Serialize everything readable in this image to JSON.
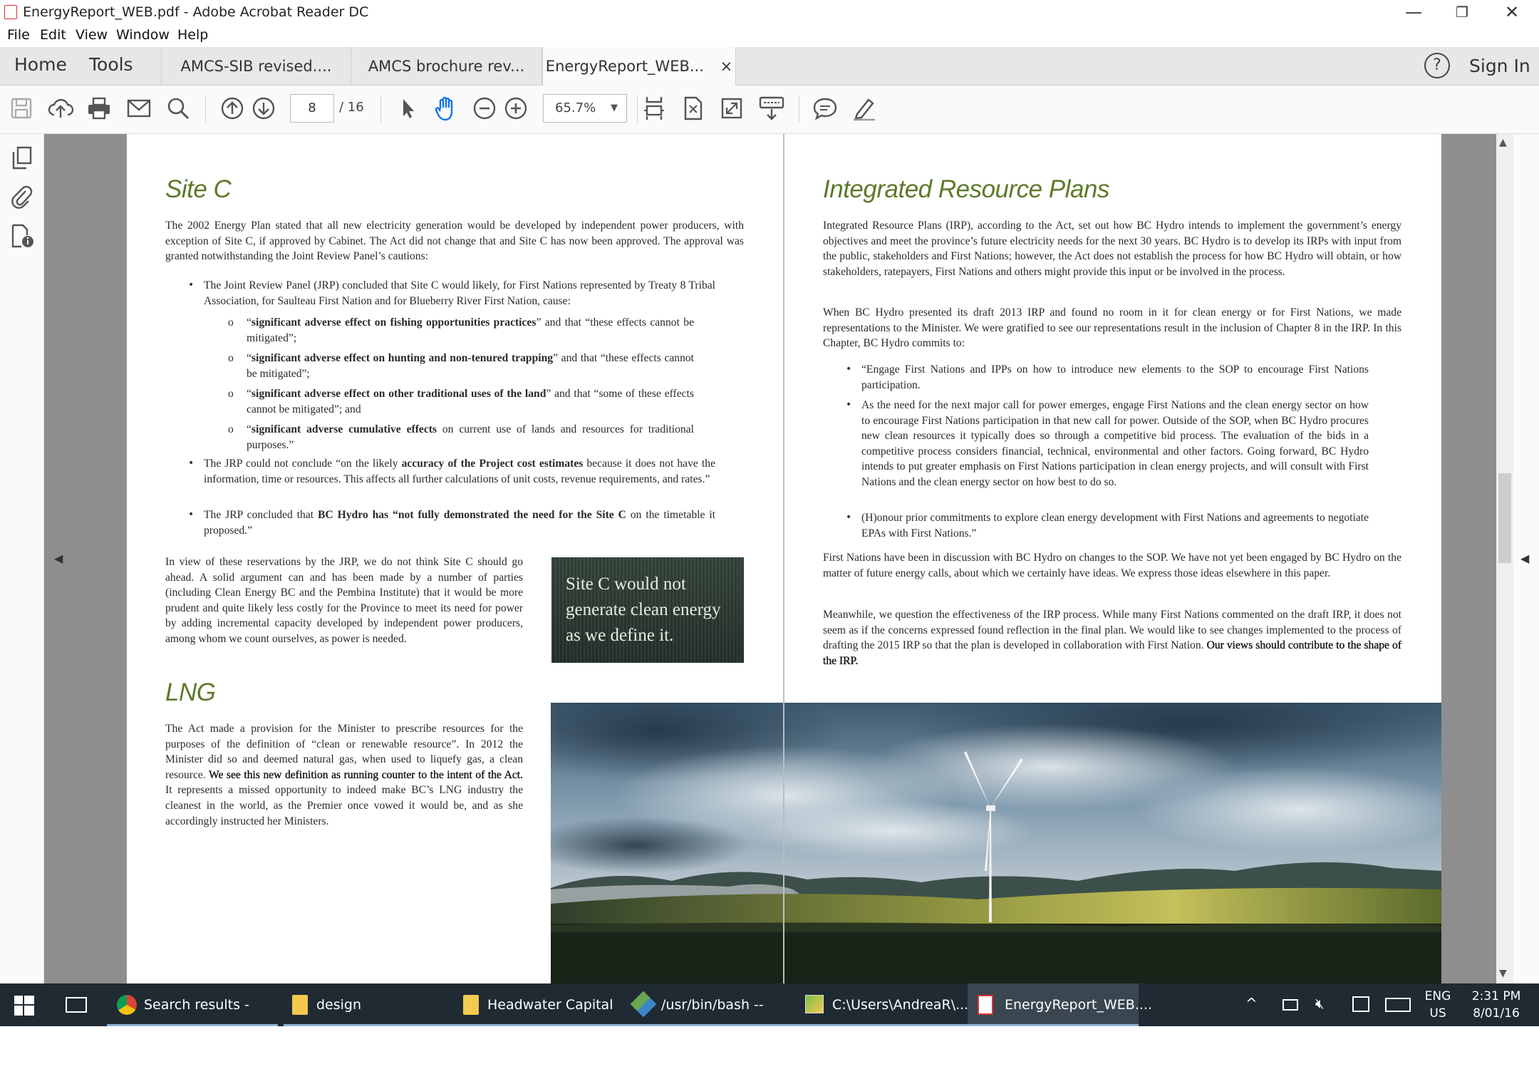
{
  "window": {
    "title": "EnergyReport_WEB.pdf - Adobe Acrobat Reader DC",
    "minimize": "—",
    "restore": "❐",
    "close": "✕"
  },
  "menu": [
    "File",
    "Edit",
    "View",
    "Window",
    "Help"
  ],
  "tabs": {
    "home": "Home",
    "tools": "Tools",
    "documents": [
      {
        "label": "AMCS-SIB revised...."
      },
      {
        "label": "AMCS brochure rev..."
      },
      {
        "label": "EnergyReport_WEB...",
        "close": "×"
      }
    ],
    "signin": "Sign In"
  },
  "toolbar": {
    "page_current": "8",
    "page_total": "/ 16",
    "zoom": "65.7%"
  },
  "left_page": {
    "heading1": "Site C",
    "p1": "The 2002 Energy Plan stated that all new electricity generation would be developed by independent power producers, with exception of Site C, if approved by Cabinet.  The Act did not change that and Site C has now been approved. The approval was granted notwithstanding the Joint Review Panel’s cautions:",
    "b1": "The Joint Review Panel (JRP) concluded that Site C would likely, for First Nations represented by Treaty 8 Tribal Association, for Saulteau First Nation and for Blueberry River First Nation, cause:",
    "sub": [
      {
        "strong": "significant adverse effect on fishing opportunities practices",
        "rest": "” and that “these effects cannot be mitigated”;"
      },
      {
        "strong": "significant adverse effect on hunting and non-tenured trapping",
        "rest": "” and that “these effects cannot be mitigated”;"
      },
      {
        "strong": "significant adverse effect on other traditional uses of the land",
        "rest": "” and that “some of these effects cannot be mitigated”; and"
      },
      {
        "strong": "significant adverse cumulative effects",
        "rest": " on current use of lands and resources for traditional purposes.”"
      }
    ],
    "b2_pre": "The JRP could not conclude “on the likely ",
    "b2_strong": "accuracy of the Project cost estimates",
    "b2_post": " because it does not have the information, time or resources. This affects all further calculations of unit costs, revenue requirements, and rates.”",
    "b3_pre": "The JRP concluded that ",
    "b3_strong": "BC Hydro has “not fully demonstrated the need for the Site C",
    "b3_post": " on the timetable it proposed.”",
    "p2": "In view of these reservations by the JRP, we do not think Site C should go ahead. A solid argument can and has been made by a number of parties (including Clean Energy BC and the Pembina Institute) that it would be more prudent and quite likely less costly for the Province to meet its need for power by adding incremental capacity developed by independent power producers, among whom we count ourselves, as power is needed.",
    "quote": "Site C would not generate clean energy as we define it.",
    "heading2": "LNG",
    "p3_pre": "The Act made a provision for the Minister to prescribe resources for the purposes of the definition of “clean or renewable resource”. In 2012 the Minister did so and deemed natural gas, when used to liquefy gas, a clean resource. ",
    "p3_strong": "We see this new definition as running counter to the intent of the Act.",
    "p3_post": " It represents a missed opportunity to indeed make BC’s LNG industry the cleanest in the world, as the Premier once vowed it would be, and as she accordingly instructed her Ministers."
  },
  "right_page": {
    "heading": "Integrated Resource Plans",
    "p1": "Integrated Resource Plans (IRP), according to the Act, set out how BC Hydro intends to implement the government’s energy objectives and meet the province’s future electricity needs for the next 30 years. BC Hydro is to develop its IRPs with input from the public, stakeholders and First Nations; however, the Act does not establish the process for how BC Hydro will obtain, or how stakeholders, ratepayers, First Nations and others might provide this input or be involved in the process.",
    "p2": "When BC Hydro presented its draft 2013 IRP and found no room in it for clean energy or for First Nations, we made representations to the Minister. We were gratified to see our representations result in the inclusion of Chapter 8 in the IRP. In this Chapter, BC Hydro commits to:",
    "bullets": [
      "“Engage First Nations and IPPs on how to introduce new elements to the SOP to encourage First Nations participation.",
      "As the need for the next major call for power emerges, engage First Nations and the clean energy sector on how to encourage First Nations participation in that new call for power. Outside of the SOP, when BC Hydro procures new clean resources it typically does so through a competitive bid process. The evaluation of the bids in a competitive process considers financial, technical, environmental and other factors. Going forward, BC Hydro intends to put greater emphasis on First Nations participation in clean energy projects, and will consult with First Nations and the clean energy sector on how best to do so.",
      "(H)onour prior commitments to explore clean energy development with First Nations and agreements to negotiate EPAs with First Nations.”"
    ],
    "p3": "First Nations have been in discussion with BC Hydro on changes to the SOP. We have not yet been engaged by BC Hydro on the matter of future energy calls, about which we certainly have ideas. We express those ideas elsewhere in this paper.",
    "p4": "Meanwhile, we question the effectiveness of the IRP process. While many First Nations commented on the draft IRP, it does not seem as if the concerns expressed found reflection in the final plan. We would like to see changes implemented to the process of drafting the 2015 IRP so that the plan is developed in collaboration with First Nation.",
    "p4_strong": "Our views should contribute to the shape of the IRP."
  },
  "taskbar": {
    "apps": [
      {
        "label": "Search results - and..."
      },
      {
        "label": "design"
      },
      {
        "label": "Headwater Capital"
      },
      {
        "label": "/usr/bin/bash --logi..."
      },
      {
        "label": "C:\\Users\\AndreaR\\..."
      },
      {
        "label": "EnergyReport_WEB...."
      }
    ],
    "lang1": "ENG",
    "lang2": "US",
    "time": "2:31 PM",
    "date": "8/01/16"
  },
  "colors": {
    "heading_green": "#5c7a2a",
    "quote_bg": "#2c3a2e",
    "taskbar": "#1f2a33",
    "acrobat_accent": "#1473e6"
  }
}
